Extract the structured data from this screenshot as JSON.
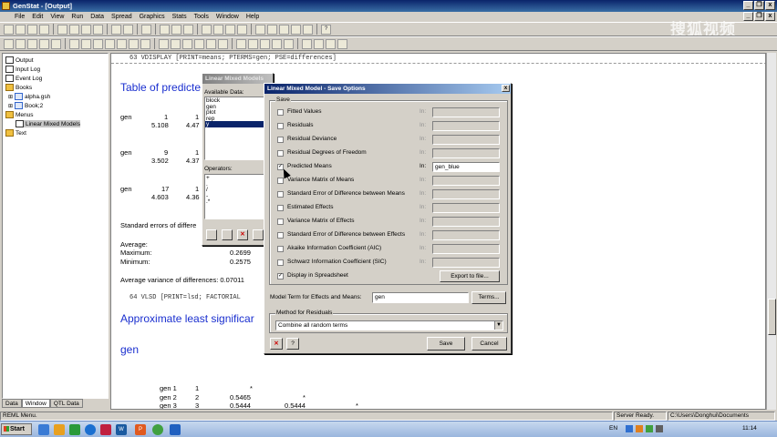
{
  "app": {
    "title": "GenStat - [Output]",
    "menu": [
      "File",
      "Edit",
      "View",
      "Run",
      "Data",
      "Spread",
      "Graphics",
      "Stats",
      "Tools",
      "Window",
      "Help"
    ],
    "window_buttons": {
      "minimize": "_",
      "restore": "❐",
      "close": "x"
    }
  },
  "watermark": "搜狐视频",
  "tree": {
    "items": [
      {
        "label": "Output",
        "icon": "doc-icon"
      },
      {
        "label": "Input Log",
        "icon": "doc-icon"
      },
      {
        "label": "Event Log",
        "icon": "doc-icon"
      },
      {
        "label": "Books",
        "icon": "folder-icon"
      },
      {
        "label": "alpha.gsh",
        "icon": "spreadsheet-icon"
      },
      {
        "label": "Book;2",
        "icon": "spreadsheet-icon"
      },
      {
        "label": "Menus",
        "icon": "folder-icon"
      },
      {
        "label": "Linear Mixed Models",
        "icon": "doc-icon"
      },
      {
        "label": "Text",
        "icon": "folder-icon"
      }
    ],
    "tabs": [
      "Data",
      "Window",
      "QTL Data"
    ]
  },
  "output": {
    "line63": "63  VDISPLAY [PRINT=means; PTERMS=gen; PSE=differences]",
    "heading1": "Table of predicte",
    "rows": [
      {
        "a": "gen",
        "b": "1",
        "c": "1"
      },
      {
        "a": "",
        "b": "5.108",
        "c": "4.47"
      },
      {
        "a": "gen",
        "b": "9",
        "c": "1"
      },
      {
        "a": "",
        "b": "3.502",
        "c": "4.37"
      },
      {
        "a": "gen",
        "b": "17",
        "c": "1"
      },
      {
        "a": "",
        "b": "4.603",
        "c": "4.36"
      }
    ],
    "se_title": "Standard errors of differe",
    "average_label": "Average:",
    "maximum_label": "Maximum:",
    "maximum_value": "0.2699",
    "minimum_label": "Minimum:",
    "minimum_value": "0.2575",
    "avg_var": "Average variance of differences: 0.07011",
    "line64": "64  VLSD [PRINT=lsd; FACTORIAL",
    "heading2": "Approximate least significar",
    "heading3": "gen",
    "table": [
      {
        "name": "gen 1",
        "n": "1",
        "v1": "*",
        "v2": "",
        "v3": ""
      },
      {
        "name": "gen 2",
        "n": "2",
        "v1": "0.5465",
        "v2": "*",
        "v3": ""
      },
      {
        "name": "gen 3",
        "n": "3",
        "v1": "0.5444",
        "v2": "0.5444",
        "v3": "*"
      }
    ]
  },
  "lmm_dialog": {
    "title": "Linear Mixed Models",
    "available_label": "Available Data:",
    "available": [
      "block",
      "gen",
      "plot",
      "rep",
      "y"
    ],
    "selected_index": 4,
    "operators_label": "Operators:",
    "operators": [
      "+",
      ".",
      "/",
      "-",
      ".*"
    ]
  },
  "save_dialog": {
    "title": "Linear Mixed Model - Save Options",
    "group_label": "Save",
    "in_label": "In:",
    "options": [
      {
        "label": "Fitted Values",
        "checked": false,
        "value": ""
      },
      {
        "label": "Residuals",
        "checked": false,
        "value": ""
      },
      {
        "label": "Residual Deviance",
        "checked": false,
        "value": ""
      },
      {
        "label": "Residual Degrees of Freedom",
        "checked": false,
        "value": ""
      },
      {
        "label": "Predicted Means",
        "checked": true,
        "value": "gen_blue"
      },
      {
        "label": "Variance Matrix of Means",
        "checked": false,
        "value": ""
      },
      {
        "label": "Standard Error of Difference between Means",
        "checked": false,
        "value": ""
      },
      {
        "label": "Estimated Effects",
        "checked": false,
        "value": ""
      },
      {
        "label": "Variance Matrix of Effects",
        "checked": false,
        "value": ""
      },
      {
        "label": "Standard Error of Difference between Effects",
        "checked": false,
        "value": ""
      },
      {
        "label": "Akaike Information Coefficient (AIC)",
        "checked": false,
        "value": ""
      },
      {
        "label": "Schwarz Information Coefficient (SIC)",
        "checked": false,
        "value": ""
      },
      {
        "label": "Display in Spreadsheet",
        "checked": true,
        "value": ""
      }
    ],
    "export_button": "Export to file...",
    "model_term_label": "Model Term for Effects and Means:",
    "model_term_value": "gen",
    "terms_button": "Terms...",
    "method_group_label": "Method for Residuals",
    "method_value": "Combine all random terms",
    "save_button": "Save",
    "cancel_button": "Cancel"
  },
  "status": {
    "left": "REML Menu.",
    "server": "Server Ready.",
    "path": "C:\\Users\\Donghui\\Documents"
  },
  "taskbar": {
    "start": "Start",
    "lang": "EN",
    "time": "11:14"
  }
}
